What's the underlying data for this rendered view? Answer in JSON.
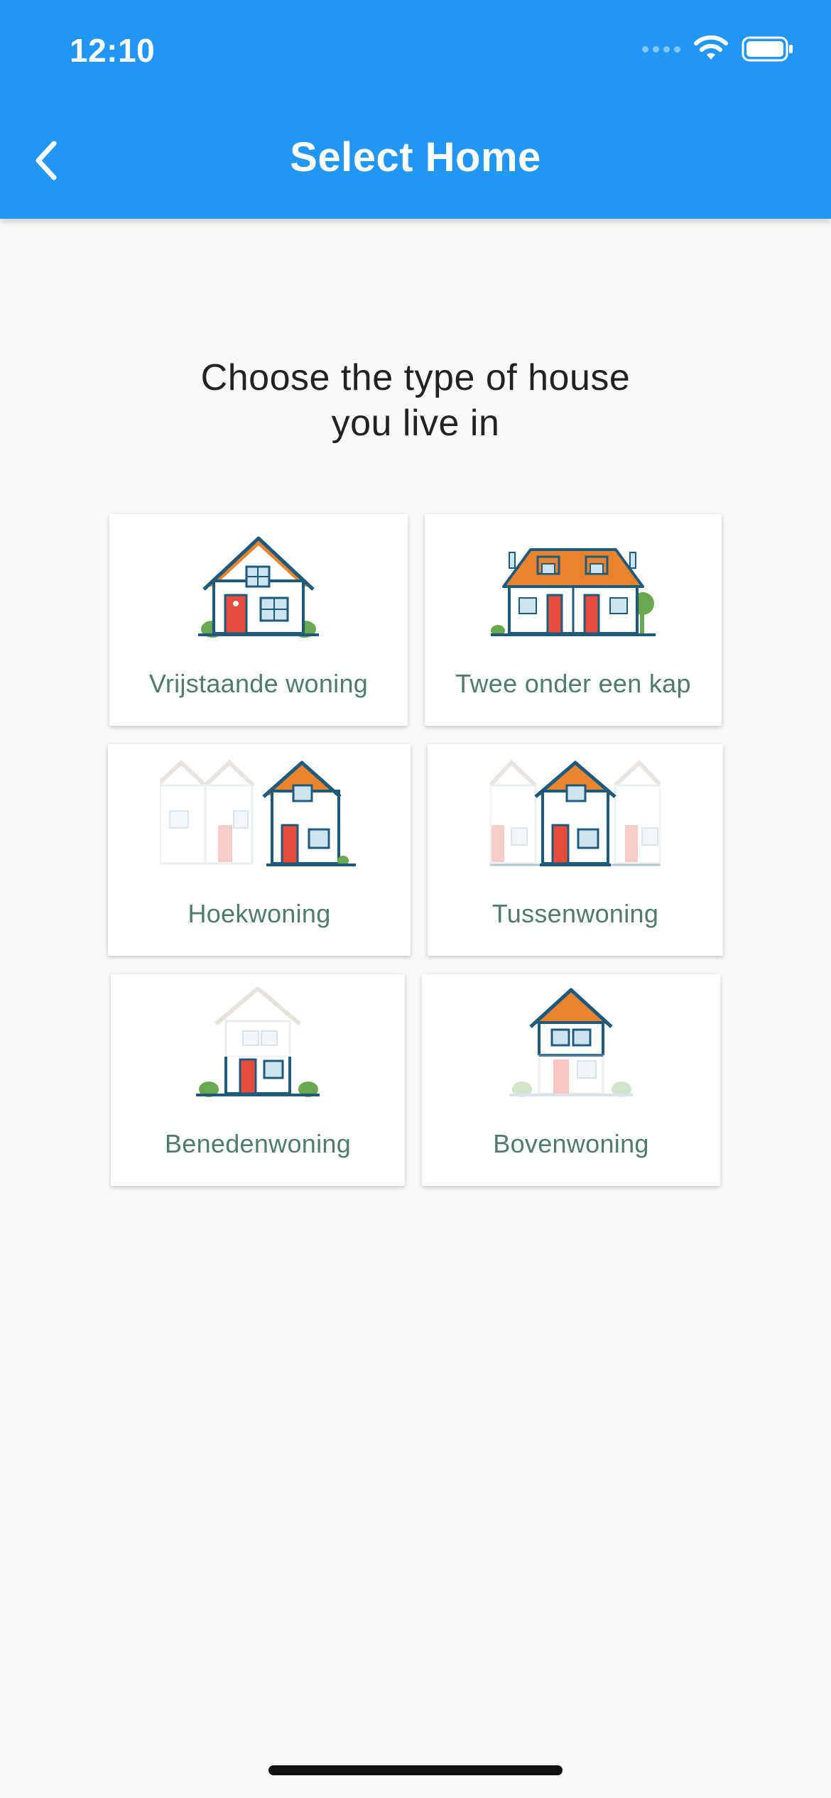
{
  "status_bar": {
    "time": "12:10",
    "icons": [
      "signal-icon",
      "wifi-icon",
      "battery-icon"
    ]
  },
  "header": {
    "title": "Select Home",
    "back_icon": "chevron-left-icon"
  },
  "prompt": {
    "line1": "Choose the type of house",
    "line2": "you live in"
  },
  "house_types": [
    {
      "label": "Vrijstaande woning",
      "icon": "detached-house-icon"
    },
    {
      "label": "Twee onder een kap",
      "icon": "semi-detached-house-icon"
    },
    {
      "label": "Hoekwoning",
      "icon": "corner-house-icon"
    },
    {
      "label": "Tussenwoning",
      "icon": "terraced-house-icon"
    },
    {
      "label": "Benedenwoning",
      "icon": "ground-floor-apartment-icon"
    },
    {
      "label": "Bovenwoning",
      "icon": "upper-floor-apartment-icon"
    }
  ],
  "colors": {
    "app_bar": "#2196f3",
    "background": "#f9f9f9",
    "label_text": "#4f7a6c",
    "house_outline": "#1f5a7a",
    "roof_accent": "#e8832f",
    "door": "#e74c3c",
    "bush": "#6aa84f"
  }
}
